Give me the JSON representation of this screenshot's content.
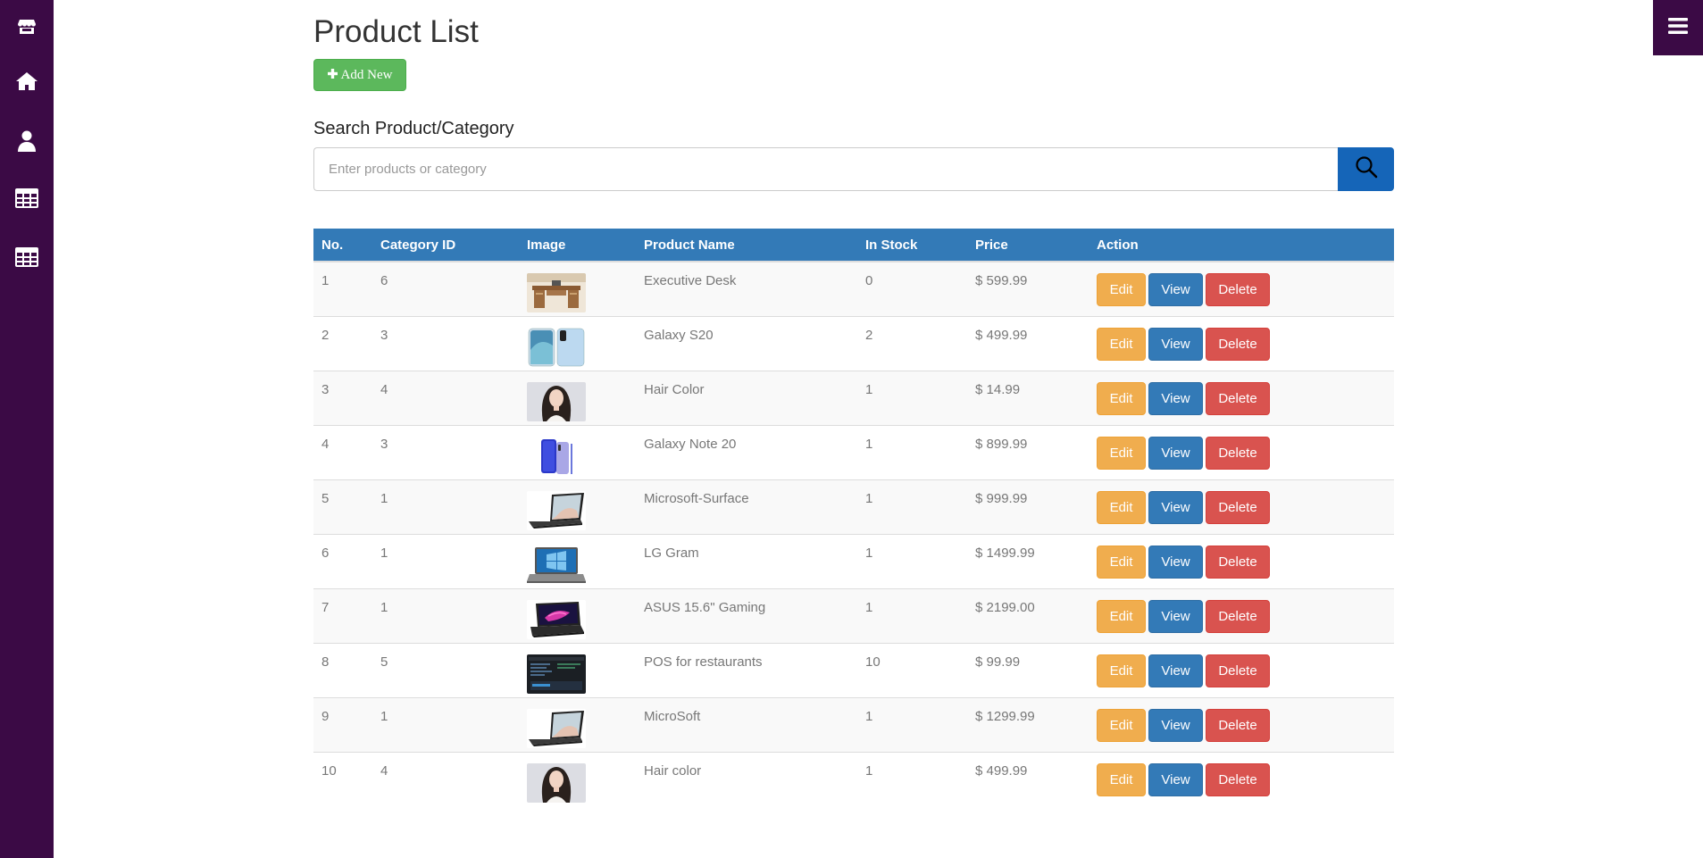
{
  "sidebar": {
    "icons": [
      "store-icon",
      "home-icon",
      "user-icon",
      "table-icon",
      "table-alt-icon"
    ]
  },
  "header": {
    "title": "Product List",
    "add_button_label": "Add New"
  },
  "search": {
    "label": "Search Product/Category",
    "placeholder": "Enter products or category"
  },
  "table": {
    "columns": [
      "No.",
      "Category ID",
      "Image",
      "Product Name",
      "In Stock",
      "Price",
      "Action"
    ],
    "action_labels": {
      "edit": "Edit",
      "view": "View",
      "delete": "Delete"
    },
    "rows": [
      {
        "no": "1",
        "category_id": "6",
        "image": "desk",
        "name": "Executive Desk",
        "stock": "0",
        "price": "$ 599.99"
      },
      {
        "no": "2",
        "category_id": "3",
        "image": "phone-s20",
        "name": "Galaxy S20",
        "stock": "2",
        "price": "$ 499.99"
      },
      {
        "no": "3",
        "category_id": "4",
        "image": "woman",
        "name": "Hair Color",
        "stock": "1",
        "price": "$ 14.99"
      },
      {
        "no": "4",
        "category_id": "3",
        "image": "phone-note",
        "name": "Galaxy Note 20",
        "stock": "1",
        "price": "$ 899.99"
      },
      {
        "no": "5",
        "category_id": "1",
        "image": "laptop-surface",
        "name": "Microsoft-Surface",
        "stock": "1",
        "price": "$ 999.99"
      },
      {
        "no": "6",
        "category_id": "1",
        "image": "laptop-gram",
        "name": "LG Gram",
        "stock": "1",
        "price": "$ 1499.99"
      },
      {
        "no": "7",
        "category_id": "1",
        "image": "laptop-gaming",
        "name": "ASUS 15.6\" Gaming",
        "stock": "1",
        "price": "$ 2199.00"
      },
      {
        "no": "8",
        "category_id": "5",
        "image": "pos-screen",
        "name": "POS for restaurants",
        "stock": "10",
        "price": "$ 99.99"
      },
      {
        "no": "9",
        "category_id": "1",
        "image": "laptop-surface",
        "name": "MicroSoft",
        "stock": "1",
        "price": "$ 1299.99"
      },
      {
        "no": "10",
        "category_id": "4",
        "image": "woman",
        "name": "Hair color",
        "stock": "1",
        "price": "$ 499.99"
      }
    ]
  },
  "colors": {
    "sidebar": "#3b0a45",
    "table_header": "#337ab7",
    "add_button": "#5cb85c",
    "search_button": "#1565b8",
    "edit_button": "#f0ad4e",
    "view_button": "#337ab7",
    "delete_button": "#d9534f"
  }
}
